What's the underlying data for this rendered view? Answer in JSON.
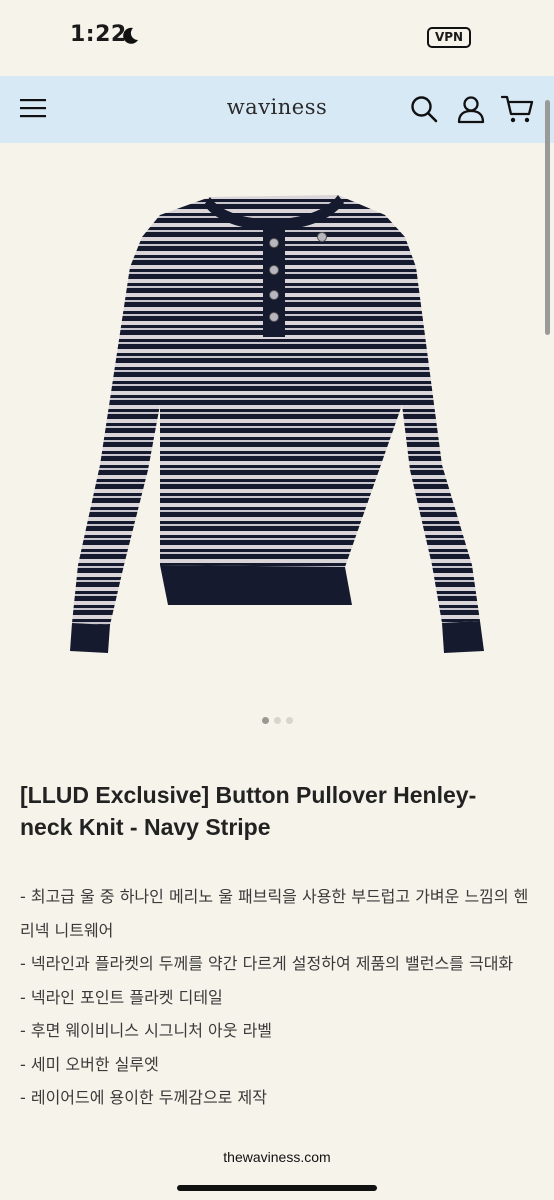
{
  "status_bar": {
    "time": "1:22",
    "vpn_label": "VPN"
  },
  "header": {
    "logo": "waviness"
  },
  "carousel": {
    "total": 3,
    "active": 1
  },
  "product": {
    "title": "[LLUD Exclusive] Button Pullover Henley-neck Knit - Navy Stripe",
    "description": [
      "- 최고급 울 중 하나인 메리노 울 패브릭을 사용한 부드럽고 가벼운 느낌의 헨리넥 니트웨어",
      "- 넥라인과 플라켓의 두께를 약간 다르게 설정하여 제품의 밸런스를 극대화",
      "- 넥라인 포인트 플라켓 디테일",
      "- 후면 웨이비니스 시그니처 아웃 라벨",
      "- 세미 오버한 실루엣",
      "- 레이어드에 용이한 두께감으로 제작"
    ]
  },
  "browser": {
    "domain": "thewaviness.com"
  },
  "colors": {
    "header_bg": "#d8e9f6",
    "page_bg": "#f6f3ea",
    "navy": "#161a2e",
    "stripe_light": "#d9d5d8"
  },
  "icons": [
    "moon-icon",
    "menu-icon",
    "search-icon",
    "account-icon",
    "cart-icon"
  ]
}
